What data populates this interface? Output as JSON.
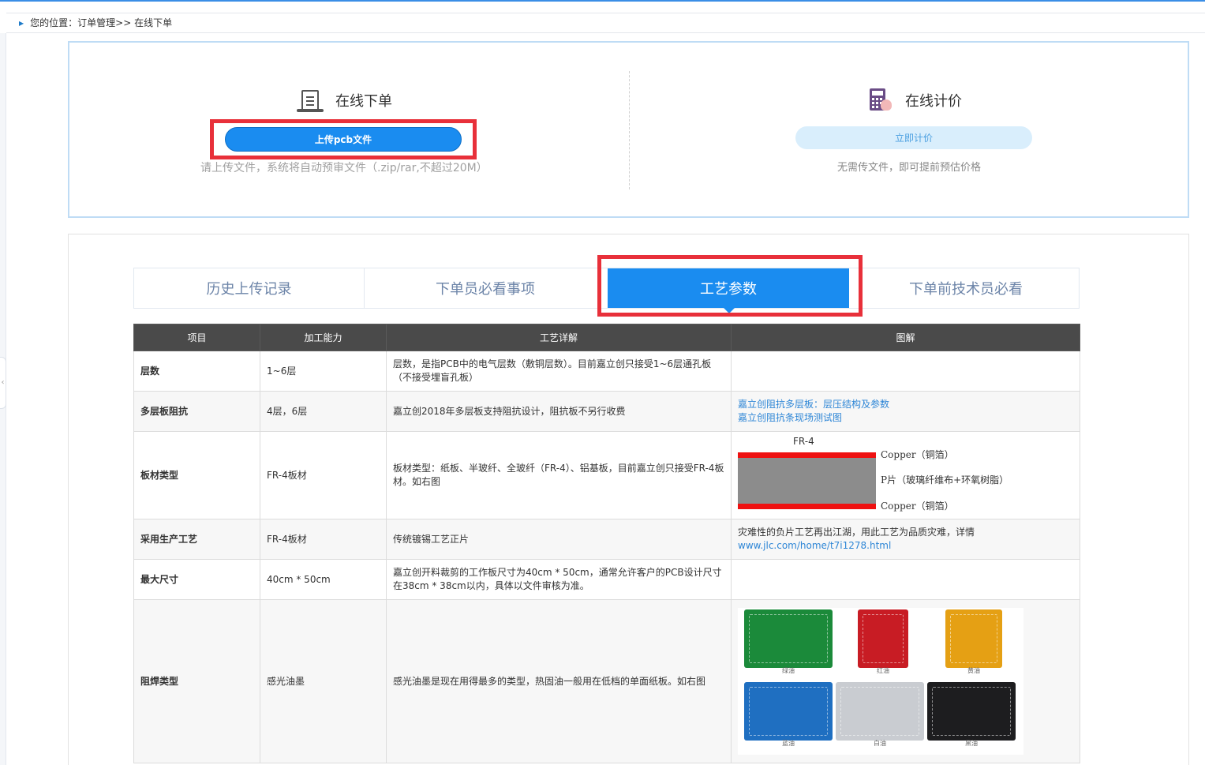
{
  "breadcrumb": {
    "prefix": "您的位置：",
    "path": "订单管理>> 在线下单"
  },
  "order_panel": {
    "title": "在线下单",
    "button_label": "上传pcb文件",
    "hint": "请上传文件，系统将自动预审文件（.zip/rar,不超过20M）"
  },
  "quote_panel": {
    "title": "在线计价",
    "button_label": "立即计价",
    "hint": "无需传文件，即可提前预估价格"
  },
  "tabs": [
    "历史上传记录",
    "下单员必看事项",
    "工艺参数",
    "下单前技术员必看"
  ],
  "active_tab": "工艺参数",
  "table": {
    "headers": [
      "项目",
      "加工能力",
      "工艺详解",
      "图解"
    ],
    "rows": [
      {
        "item": "层数",
        "capability": "1~6层",
        "detail": "层数，是指PCB中的电气层数（敷铜层数）。目前嘉立创只接受1~6层通孔板（不接受埋盲孔板）"
      },
      {
        "item": "多层板阻抗",
        "capability": "4层，6层",
        "detail": "嘉立创2018年多层板支持阻抗设计，阻抗板不另行收费",
        "links": [
          "嘉立创阻抗多层板：层压结构及参数",
          "嘉立创阻抗条现场测试图"
        ]
      },
      {
        "item": "板材类型",
        "capability": "FR-4板材",
        "detail": "板材类型：纸板、半玻纤、全玻纤（FR-4）、铝基板，目前嘉立创只接受FR-4板材。如右图",
        "diagram": {
          "title": "FR-4",
          "top_label": "Copper（铜箔）",
          "middle_label": "P片（玻璃纤维布+环氧树脂）",
          "bottom_label": "Copper（铜箔）"
        }
      },
      {
        "item": "采用生产工艺",
        "capability": "FR-4板材",
        "detail": "传统镀锡工艺正片",
        "note": "灾难性的负片工艺再出江湖，用此工艺为品质灾难，详情",
        "link": "www.jlc.com/home/t7i1278.html"
      },
      {
        "item": "最大尺寸",
        "capability": "40cm * 50cm",
        "detail": "嘉立创开料裁剪的工作板尺寸为40cm * 50cm，通常允许客户的PCB设计尺寸在38cm * 38cm以内，具体以文件审核为准。"
      },
      {
        "item": "阻焊类型",
        "capability": "感光油墨",
        "detail": "感光油墨是现在用得最多的类型，热固油一般用在低档的单面纸板。如右图",
        "boards": [
          "绿油",
          "红油",
          "黄油",
          "蓝油",
          "白油",
          "黑油"
        ]
      }
    ]
  },
  "colors": {
    "accent": "#1a8cf0",
    "highlight_frame": "#e8303a",
    "table_header": "#4a4a4a",
    "link": "#2e86d6"
  }
}
